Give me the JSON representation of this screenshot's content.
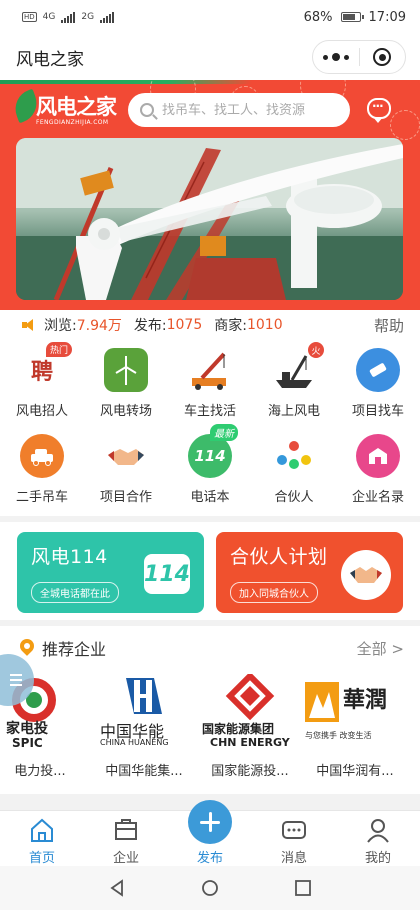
{
  "status_bar": {
    "carrier_left": "HD",
    "network1": "4G",
    "network2": "2G",
    "battery": "68%",
    "time": "17:09"
  },
  "nav": {
    "title": "风电之家"
  },
  "header": {
    "logo_text": "风电之家",
    "logo_sub": "FENGDIANZHIJIA.COM",
    "search_placeholder": "找吊车、找工人、找资源"
  },
  "stats": {
    "views_label": "浏览:",
    "views_value": "7.94万",
    "posts_label": "发布:",
    "posts_value": "1075",
    "merchants_label": "商家:",
    "merchants_value": "1010",
    "help": "帮助"
  },
  "grid": [
    {
      "label": "风电招人",
      "icon": "recruit-icon",
      "tag": "热门"
    },
    {
      "label": "风电转场",
      "icon": "wind-transfer-icon"
    },
    {
      "label": "车主找活",
      "icon": "crane-truck-icon"
    },
    {
      "label": "海上风电",
      "icon": "offshore-crane-icon",
      "tag": "火"
    },
    {
      "label": "项目找车",
      "icon": "project-car-icon"
    },
    {
      "label": "二手吊车",
      "icon": "used-crane-icon"
    },
    {
      "label": "项目合作",
      "icon": "handshake-icon"
    },
    {
      "label": "电话本",
      "icon": "phonebook-icon",
      "tag": "最新",
      "glyph": "114"
    },
    {
      "label": "合伙人",
      "icon": "partner-icon"
    },
    {
      "label": "企业名录",
      "icon": "company-directory-icon"
    }
  ],
  "promos": {
    "left": {
      "title": "风电114",
      "sub": "全城电话都在此",
      "badge": "114"
    },
    "right": {
      "title": "合伙人计划",
      "sub": "加入同城合伙人"
    }
  },
  "recommend": {
    "title": "推荐企业",
    "all": "全部 >",
    "companies": [
      {
        "name": "电力投...",
        "logo_text": "家电投",
        "logo_sub": "SPIC"
      },
      {
        "name": "中国华能集...",
        "logo_text": "中国华能",
        "logo_sub": "CHINA HUANENG"
      },
      {
        "name": "国家能源投...",
        "logo_text": "国家能源集团",
        "logo_sub": "CHN ENERGY"
      },
      {
        "name": "中国华润有...",
        "logo_text": "華潤",
        "logo_sub": "与您携手 改变生活"
      }
    ]
  },
  "tabbar": [
    {
      "label": "首页",
      "icon": "home-icon",
      "active": true
    },
    {
      "label": "企业",
      "icon": "company-icon"
    },
    {
      "label": "发布",
      "icon": "plus-icon"
    },
    {
      "label": "消息",
      "icon": "message-icon"
    },
    {
      "label": "我的",
      "icon": "profile-icon"
    }
  ],
  "colors": {
    "brand_red": "#f24a35",
    "brand_green": "#2e9d4c",
    "teal": "#2ec4a9",
    "orange_red": "#f0512e",
    "accent_blue": "#2a8bd3"
  }
}
